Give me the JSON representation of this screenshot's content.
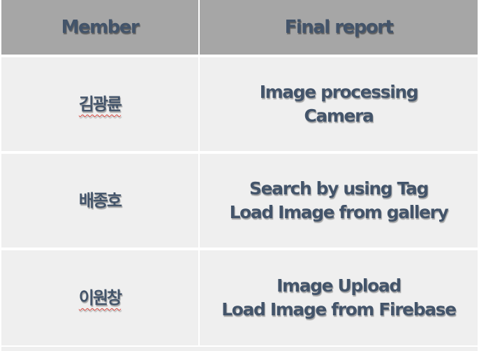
{
  "table": {
    "headers": [
      "Member",
      "Final report"
    ],
    "rows": [
      {
        "member": "김광륜",
        "report": [
          "Image processing",
          "Camera"
        ]
      },
      {
        "member": "배종호",
        "report": [
          "Search by using Tag",
          "Load Image from gallery"
        ]
      },
      {
        "member": "이원창",
        "report": [
          "Image Upload",
          "Load Image from Firebase"
        ]
      }
    ]
  },
  "colors": {
    "header_bg": "#a6a6a6",
    "row_bg": "#efefef",
    "text": "#43546a",
    "spellcheck_underline": "#d9473f"
  }
}
